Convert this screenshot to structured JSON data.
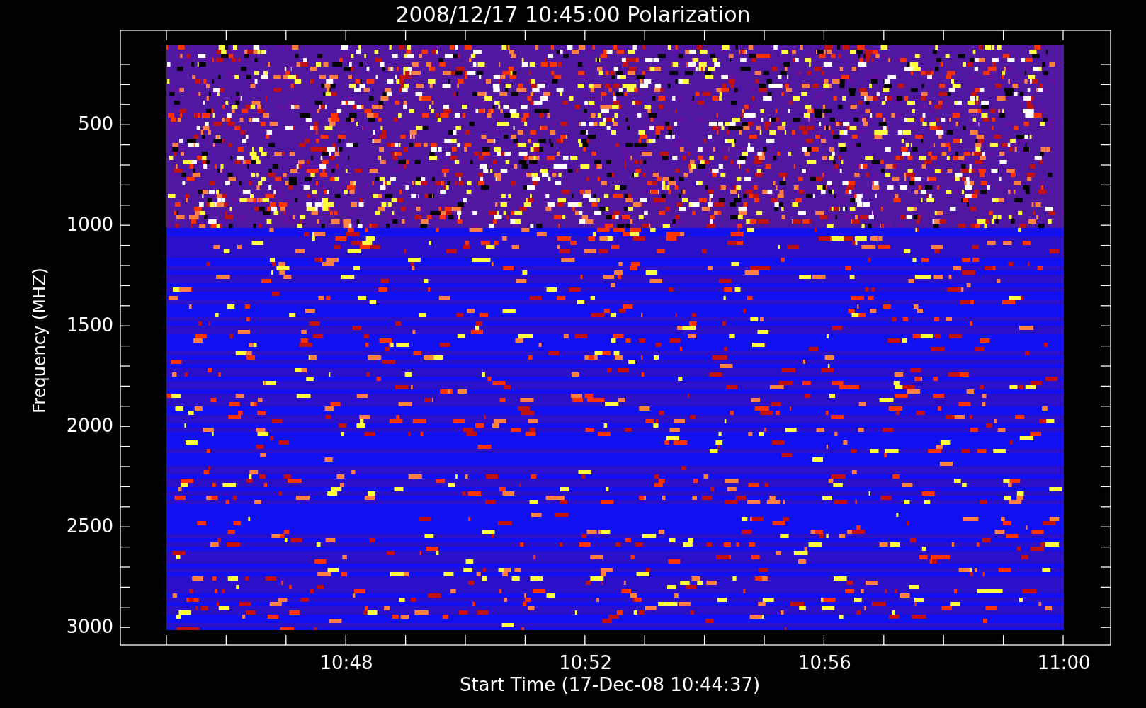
{
  "title": "2008/12/17 10:45:00 Polarization",
  "y_axis": {
    "label": "Frequency (MHZ)",
    "tick_labels": [
      "500",
      "1000",
      "1500",
      "2000",
      "2500",
      "3000"
    ]
  },
  "x_axis": {
    "label": "Start Time (17-Dec-08 10:44:37)",
    "tick_labels": [
      "10:48",
      "10:52",
      "10:56",
      "11:00"
    ]
  }
}
